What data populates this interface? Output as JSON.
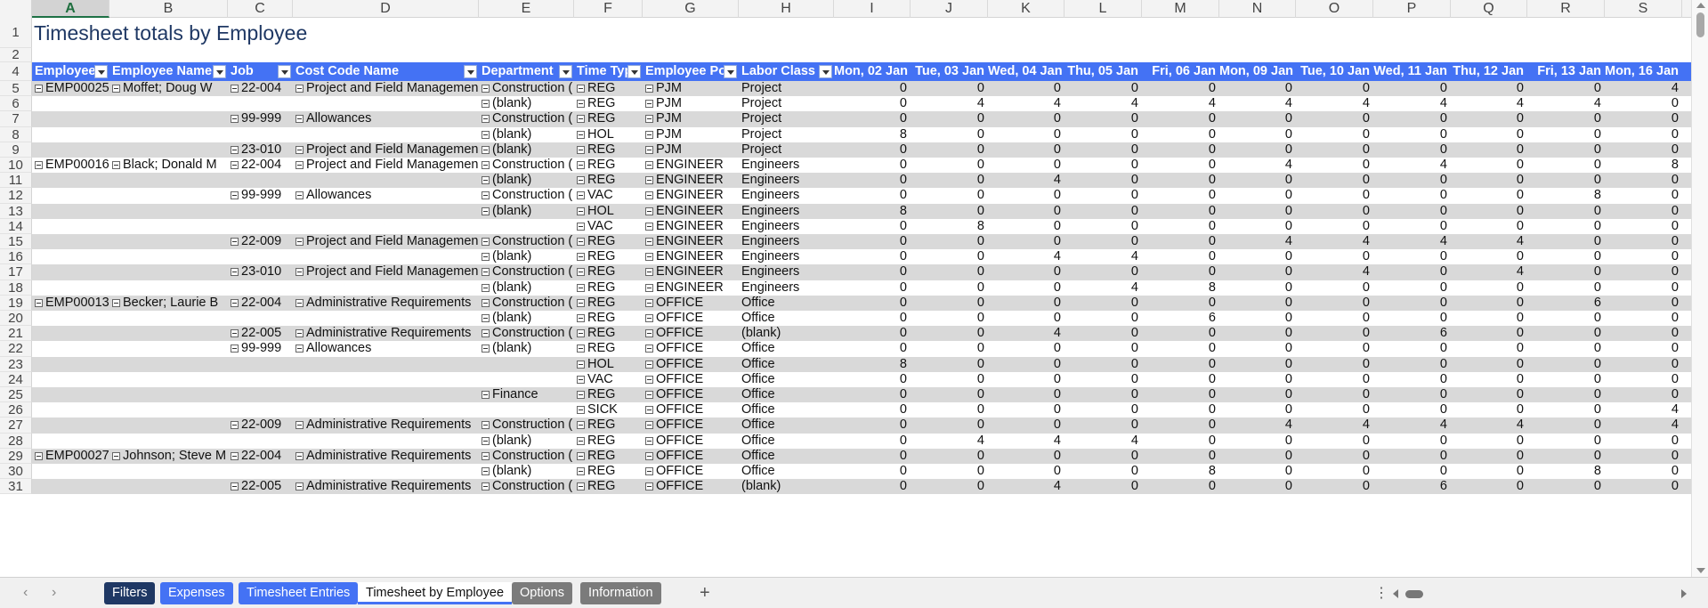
{
  "sheet_title": "Timesheet totals by Employee",
  "columns": [
    "A",
    "B",
    "C",
    "D",
    "E",
    "F",
    "G",
    "H",
    "I",
    "J",
    "K",
    "L",
    "M",
    "N",
    "O",
    "P",
    "Q",
    "R",
    "S"
  ],
  "selected_column": "A",
  "headers": [
    "Employee",
    "Employee Name",
    "Job",
    "Cost Code Name",
    "Department",
    "Time Typ",
    "Employee Po",
    "Labor Class",
    "Mon, 02 Jan",
    "Tue, 03 Jan",
    "Wed, 04 Jan",
    "Thu, 05 Jan",
    "Fri, 06 Jan",
    "Mon, 09 Jan",
    "Tue, 10 Jan",
    "Wed, 11 Jan",
    "Thu, 12 Jan",
    "Fri, 13 Jan",
    "Mon, 16 Jan"
  ],
  "rows": [
    {
      "n": "5",
      "emp": "EMP00025",
      "name": "Moffet; Doug W",
      "job": "22-004",
      "cc": "Project and Field Managemen",
      "dept": "Construction (",
      "tt": "REG",
      "pos": "PJM",
      "lc": "Project",
      "v": [
        "0",
        "0",
        "0",
        "0",
        "0",
        "0",
        "0",
        "0",
        "0",
        "0",
        "4"
      ]
    },
    {
      "n": "6",
      "emp": "",
      "name": "",
      "job": "",
      "cc": "",
      "dept": "(blank)",
      "tt": "REG",
      "pos": "PJM",
      "lc": "Project",
      "v": [
        "0",
        "4",
        "4",
        "4",
        "4",
        "4",
        "4",
        "4",
        "4",
        "4",
        "0"
      ]
    },
    {
      "n": "7",
      "emp": "",
      "name": "",
      "job": "99-999",
      "cc": "Allowances",
      "dept": "Construction (",
      "tt": "REG",
      "pos": "PJM",
      "lc": "Project",
      "v": [
        "0",
        "0",
        "0",
        "0",
        "0",
        "0",
        "0",
        "0",
        "0",
        "0",
        "0"
      ]
    },
    {
      "n": "8",
      "emp": "",
      "name": "",
      "job": "",
      "cc": "",
      "dept": "(blank)",
      "tt": "HOL",
      "pos": "PJM",
      "lc": "Project",
      "v": [
        "8",
        "0",
        "0",
        "0",
        "0",
        "0",
        "0",
        "0",
        "0",
        "0",
        "0"
      ]
    },
    {
      "n": "9",
      "emp": "",
      "name": "",
      "job": "23-010",
      "cc": "Project and Field Managemen",
      "dept": "(blank)",
      "tt": "REG",
      "pos": "PJM",
      "lc": "Project",
      "v": [
        "0",
        "0",
        "0",
        "0",
        "0",
        "0",
        "0",
        "0",
        "0",
        "0",
        "0"
      ]
    },
    {
      "n": "10",
      "emp": "EMP00016",
      "name": "Black; Donald M",
      "job": "22-004",
      "cc": "Project and Field Managemen",
      "dept": "Construction (",
      "tt": "REG",
      "pos": "ENGINEER",
      "lc": "Engineers",
      "v": [
        "0",
        "0",
        "0",
        "0",
        "0",
        "4",
        "0",
        "4",
        "0",
        "0",
        "8"
      ]
    },
    {
      "n": "11",
      "emp": "",
      "name": "",
      "job": "",
      "cc": "",
      "dept": "(blank)",
      "tt": "REG",
      "pos": "ENGINEER",
      "lc": "Engineers",
      "v": [
        "0",
        "0",
        "4",
        "0",
        "0",
        "0",
        "0",
        "0",
        "0",
        "0",
        "0"
      ]
    },
    {
      "n": "12",
      "emp": "",
      "name": "",
      "job": "99-999",
      "cc": "Allowances",
      "dept": "Construction (",
      "tt": "VAC",
      "pos": "ENGINEER",
      "lc": "Engineers",
      "v": [
        "0",
        "0",
        "0",
        "0",
        "0",
        "0",
        "0",
        "0",
        "0",
        "8",
        "0"
      ]
    },
    {
      "n": "13",
      "emp": "",
      "name": "",
      "job": "",
      "cc": "",
      "dept": "(blank)",
      "tt": "HOL",
      "pos": "ENGINEER",
      "lc": "Engineers",
      "v": [
        "8",
        "0",
        "0",
        "0",
        "0",
        "0",
        "0",
        "0",
        "0",
        "0",
        "0"
      ]
    },
    {
      "n": "14",
      "emp": "",
      "name": "",
      "job": "",
      "cc": "",
      "dept": "",
      "tt": "VAC",
      "pos": "ENGINEER",
      "lc": "Engineers",
      "v": [
        "0",
        "8",
        "0",
        "0",
        "0",
        "0",
        "0",
        "0",
        "0",
        "0",
        "0"
      ]
    },
    {
      "n": "15",
      "emp": "",
      "name": "",
      "job": "22-009",
      "cc": "Project and Field Managemen",
      "dept": "Construction (",
      "tt": "REG",
      "pos": "ENGINEER",
      "lc": "Engineers",
      "v": [
        "0",
        "0",
        "0",
        "0",
        "0",
        "4",
        "4",
        "4",
        "4",
        "0",
        "0"
      ]
    },
    {
      "n": "16",
      "emp": "",
      "name": "",
      "job": "",
      "cc": "",
      "dept": "(blank)",
      "tt": "REG",
      "pos": "ENGINEER",
      "lc": "Engineers",
      "v": [
        "0",
        "0",
        "4",
        "4",
        "0",
        "0",
        "0",
        "0",
        "0",
        "0",
        "0"
      ]
    },
    {
      "n": "17",
      "emp": "",
      "name": "",
      "job": "23-010",
      "cc": "Project and Field Managemen",
      "dept": "Construction (",
      "tt": "REG",
      "pos": "ENGINEER",
      "lc": "Engineers",
      "v": [
        "0",
        "0",
        "0",
        "0",
        "0",
        "0",
        "4",
        "0",
        "4",
        "0",
        "0"
      ]
    },
    {
      "n": "18",
      "emp": "",
      "name": "",
      "job": "",
      "cc": "",
      "dept": "(blank)",
      "tt": "REG",
      "pos": "ENGINEER",
      "lc": "Engineers",
      "v": [
        "0",
        "0",
        "0",
        "4",
        "8",
        "0",
        "0",
        "0",
        "0",
        "0",
        "0"
      ]
    },
    {
      "n": "19",
      "emp": "EMP00013",
      "name": "Becker; Laurie B",
      "job": "22-004",
      "cc": "Administrative Requirements",
      "dept": "Construction (",
      "tt": "REG",
      "pos": "OFFICE",
      "lc": "Office",
      "v": [
        "0",
        "0",
        "0",
        "0",
        "0",
        "0",
        "0",
        "0",
        "0",
        "6",
        "0"
      ]
    },
    {
      "n": "20",
      "emp": "",
      "name": "",
      "job": "",
      "cc": "",
      "dept": "(blank)",
      "tt": "REG",
      "pos": "OFFICE",
      "lc": "Office",
      "v": [
        "0",
        "0",
        "0",
        "0",
        "6",
        "0",
        "0",
        "0",
        "0",
        "0",
        "0"
      ]
    },
    {
      "n": "21",
      "emp": "",
      "name": "",
      "job": "22-005",
      "cc": "Administrative Requirements",
      "dept": "Construction (",
      "tt": "REG",
      "pos": "OFFICE",
      "lc": "(blank)",
      "v": [
        "0",
        "0",
        "4",
        "0",
        "0",
        "0",
        "0",
        "6",
        "0",
        "0",
        "0"
      ]
    },
    {
      "n": "22",
      "emp": "",
      "name": "",
      "job": "99-999",
      "cc": "Allowances",
      "dept": "(blank)",
      "tt": "REG",
      "pos": "OFFICE",
      "lc": "Office",
      "v": [
        "0",
        "0",
        "0",
        "0",
        "0",
        "0",
        "0",
        "0",
        "0",
        "0",
        "0"
      ]
    },
    {
      "n": "23",
      "emp": "",
      "name": "",
      "job": "",
      "cc": "",
      "dept": "",
      "tt": "HOL",
      "pos": "OFFICE",
      "lc": "Office",
      "v": [
        "8",
        "0",
        "0",
        "0",
        "0",
        "0",
        "0",
        "0",
        "0",
        "0",
        "0"
      ]
    },
    {
      "n": "24",
      "emp": "",
      "name": "",
      "job": "",
      "cc": "",
      "dept": "",
      "tt": "VAC",
      "pos": "OFFICE",
      "lc": "Office",
      "v": [
        "0",
        "0",
        "0",
        "0",
        "0",
        "0",
        "0",
        "0",
        "0",
        "0",
        "0"
      ]
    },
    {
      "n": "25",
      "emp": "",
      "name": "",
      "job": "",
      "cc": "",
      "dept": "Finance",
      "tt": "REG",
      "pos": "OFFICE",
      "lc": "Office",
      "v": [
        "0",
        "0",
        "0",
        "0",
        "0",
        "0",
        "0",
        "0",
        "0",
        "0",
        "0"
      ]
    },
    {
      "n": "26",
      "emp": "",
      "name": "",
      "job": "",
      "cc": "",
      "dept": "",
      "tt": "SICK",
      "pos": "OFFICE",
      "lc": "Office",
      "v": [
        "0",
        "0",
        "0",
        "0",
        "0",
        "0",
        "0",
        "0",
        "0",
        "0",
        "4"
      ]
    },
    {
      "n": "27",
      "emp": "",
      "name": "",
      "job": "22-009",
      "cc": "Administrative Requirements",
      "dept": "Construction (",
      "tt": "REG",
      "pos": "OFFICE",
      "lc": "Office",
      "v": [
        "0",
        "0",
        "0",
        "0",
        "0",
        "4",
        "4",
        "4",
        "4",
        "0",
        "4"
      ]
    },
    {
      "n": "28",
      "emp": "",
      "name": "",
      "job": "",
      "cc": "",
      "dept": "(blank)",
      "tt": "REG",
      "pos": "OFFICE",
      "lc": "Office",
      "v": [
        "0",
        "4",
        "4",
        "4",
        "0",
        "0",
        "0",
        "0",
        "0",
        "0",
        "0"
      ]
    },
    {
      "n": "29",
      "emp": "EMP00027",
      "name": "Johnson; Steve M",
      "job": "22-004",
      "cc": "Administrative Requirements",
      "dept": "Construction (",
      "tt": "REG",
      "pos": "OFFICE",
      "lc": "Office",
      "v": [
        "0",
        "0",
        "0",
        "0",
        "0",
        "0",
        "0",
        "0",
        "0",
        "0",
        "0"
      ]
    },
    {
      "n": "30",
      "emp": "",
      "name": "",
      "job": "",
      "cc": "",
      "dept": "(blank)",
      "tt": "REG",
      "pos": "OFFICE",
      "lc": "Office",
      "v": [
        "0",
        "0",
        "0",
        "0",
        "8",
        "0",
        "0",
        "0",
        "0",
        "8",
        "0"
      ]
    },
    {
      "n": "31",
      "emp": "",
      "name": "",
      "job": "22-005",
      "cc": "Administrative Requirements",
      "dept": "Construction (",
      "tt": "REG",
      "pos": "OFFICE",
      "lc": "(blank)",
      "v": [
        "0",
        "0",
        "4",
        "0",
        "0",
        "0",
        "0",
        "6",
        "0",
        "0",
        "0"
      ]
    }
  ],
  "row_labels_top": [
    "1",
    "2",
    "4"
  ],
  "tabs": [
    {
      "label": "Filters",
      "style": "filters"
    },
    {
      "label": "Expenses",
      "style": "blue"
    },
    {
      "label": "Timesheet Entries",
      "style": "blue"
    },
    {
      "label": "Timesheet by Employee",
      "style": "active"
    },
    {
      "label": "Options",
      "style": "gray"
    },
    {
      "label": "Information",
      "style": "gray"
    }
  ],
  "add_tab": "+",
  "more": "⋮"
}
